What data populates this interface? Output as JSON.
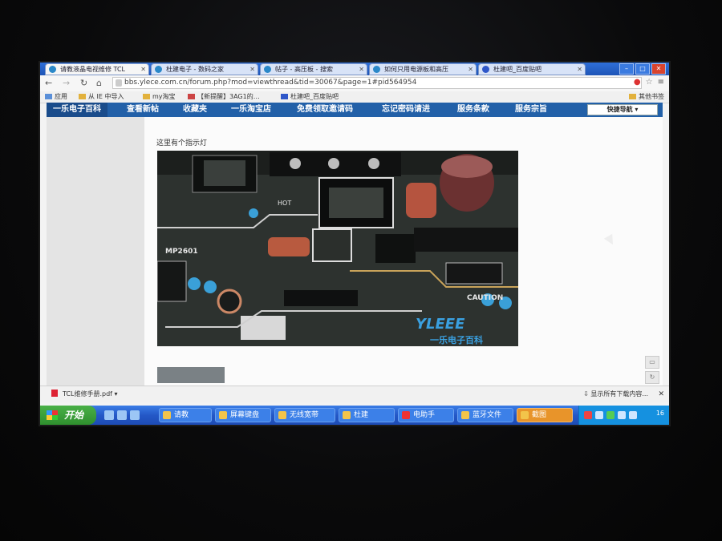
{
  "browser": {
    "tabs": [
      {
        "label": "请教液晶电视维修 TCL"
      },
      {
        "label": "杜建电子 - 数码之家"
      },
      {
        "label": "帖子 - 高压板 - 搜索"
      },
      {
        "label": "如何只用电源板和高压"
      },
      {
        "label": "杜建吧_百度贴吧"
      }
    ],
    "url": "bbs.ylece.com.cn/forum.php?mod=viewthread&tid=30067&page=1#pid564954",
    "bookmarks": [
      "应用",
      "从 IE 中导入",
      "my淘宝",
      "【新提醒】3AG1的…",
      "杜建吧_百度贴吧",
      "其他书签"
    ]
  },
  "site_nav": {
    "items": [
      "一乐电子百科",
      "查看新帖",
      "收藏夹",
      "一乐淘宝店",
      "免费领取邀请码",
      "忘记密码请进",
      "服务条款",
      "服务宗旨"
    ],
    "quick_nav": "快捷导航"
  },
  "post": {
    "text": "这里有个指示灯",
    "photo": {
      "labels": [
        "MP2601",
        "CAUTION",
        "HOT"
      ],
      "watermark_brand": "YLEEE",
      "watermark_text": "一乐电子百科"
    }
  },
  "downloads": {
    "file": "TCL维修手册.pdf",
    "show_all": "显示所有下载内容..."
  },
  "taskbar": {
    "start": "开始",
    "tasks": [
      "请教",
      "屏幕键盘",
      "无线宽带",
      "杜建",
      "电助手",
      "蓝牙文件",
      "截图"
    ],
    "clock": "16"
  }
}
